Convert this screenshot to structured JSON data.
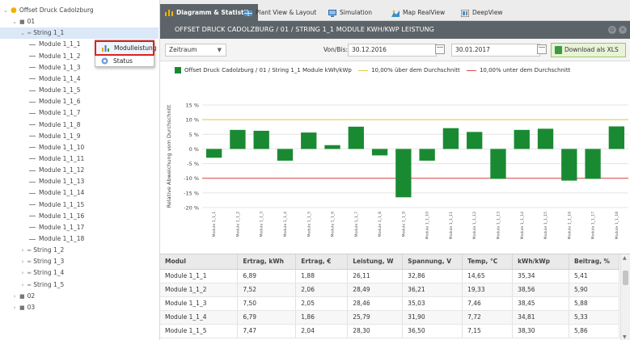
{
  "tree": {
    "root": "Offset Druck Cadolzburg",
    "inverter_01": "01",
    "inverter_02": "02",
    "inverter_03": "03",
    "strings": [
      "String 1_1",
      "String 1_2",
      "String 1_3",
      "String 1_4",
      "String 1_5"
    ],
    "modules": [
      "Module 1_1_1",
      "Module 1_1_2",
      "Module 1_1_3",
      "Module 1_1_4",
      "Module 1_1_5",
      "Module 1_1_6",
      "Module 1_1_7",
      "Module 1_1_8",
      "Module 1_1_9",
      "Module 1_1_10",
      "Module 1_1_11",
      "Module 1_1_12",
      "Module 1_1_13",
      "Module 1_1_14",
      "Module 1_1_15",
      "Module 1_1_16",
      "Module 1_1_17",
      "Module 1_1_18"
    ]
  },
  "context_menu": {
    "items": [
      "Modulleistung",
      "Status"
    ]
  },
  "tabs": [
    "Diagramm & Statistik",
    "Plant View & Layout",
    "Simulation",
    "Map RealView",
    "DeepView"
  ],
  "panel": {
    "title": "OFFSET DRUCK CADOLZBURG / 01 / STRING 1_1 MODULE KWH/KWP LEISTUNG"
  },
  "toolbar": {
    "period_select": "Zeitraum",
    "range_label": "Von/Bis:",
    "date_from": "30.12.2016",
    "date_to": "30.01.2017",
    "download_label": "Download als XLS"
  },
  "colors": {
    "bar": "#1a8a32",
    "upper_line": "#e6c94a",
    "lower_line": "#d84848",
    "titlebar": "#5d6469"
  },
  "chart_data": {
    "type": "bar",
    "legend": [
      "Offset Druck Cadolzburg / 01 / String 1_1 Module kWh/kWp",
      "10,00% über dem Durchschnitt",
      "10,00% unter dem Durchschnitt"
    ],
    "ylabel": "Relative Abweichung vom Durchschnitt",
    "yticks": [
      "15 %",
      "10 %",
      "5 %",
      "0 %",
      "-5 %",
      "-10 %",
      "-15 %",
      "-20 %"
    ],
    "ylim": [
      -20,
      15
    ],
    "categories": [
      "Module 1_1_1",
      "Module 1_1_2",
      "Module 1_1_3",
      "Module 1_1_4",
      "Module 1_1_5",
      "Module 1_1_6",
      "Module 1_1_7",
      "Module 1_1_8",
      "Module 1_1_9",
      "Module 1_1_10",
      "Module 1_1_11",
      "Module 1_1_12",
      "Module 1_1_13",
      "Module 1_1_14",
      "Module 1_1_15",
      "Module 1_1_16",
      "Module 1_1_17",
      "Module 1_1_18"
    ],
    "values": [
      -3,
      6.5,
      6.2,
      -4,
      5.6,
      1.3,
      7.6,
      -2.2,
      -16.5,
      -4,
      7.1,
      5.8,
      -10.2,
      6.5,
      6.9,
      -10.8,
      -10.2,
      7.7
    ],
    "reference_lines": [
      10,
      -10
    ],
    "grid": true
  },
  "table": {
    "columns": [
      "Modul",
      "Ertrag, kWh",
      "Ertrag, €",
      "Leistung, W",
      "Spannung, V",
      "Temp, °C",
      "kWh/kWp",
      "Beitrag, %"
    ],
    "rows": [
      [
        "Module 1_1_1",
        "6,89",
        "1,88",
        "26,11",
        "32,86",
        "14,65",
        "35,34",
        "5,41"
      ],
      [
        "Module 1_1_2",
        "7,52",
        "2,06",
        "28,49",
        "36,21",
        "19,33",
        "38,56",
        "5,90"
      ],
      [
        "Module 1_1_3",
        "7,50",
        "2,05",
        "28,46",
        "35,03",
        "7,46",
        "38,45",
        "5,88"
      ],
      [
        "Module 1_1_4",
        "6,79",
        "1,86",
        "25,79",
        "31,90",
        "7,72",
        "34,81",
        "5,33"
      ],
      [
        "Module 1_1_5",
        "7,47",
        "2,04",
        "28,30",
        "36,50",
        "7,15",
        "38,30",
        "5,86"
      ]
    ]
  }
}
